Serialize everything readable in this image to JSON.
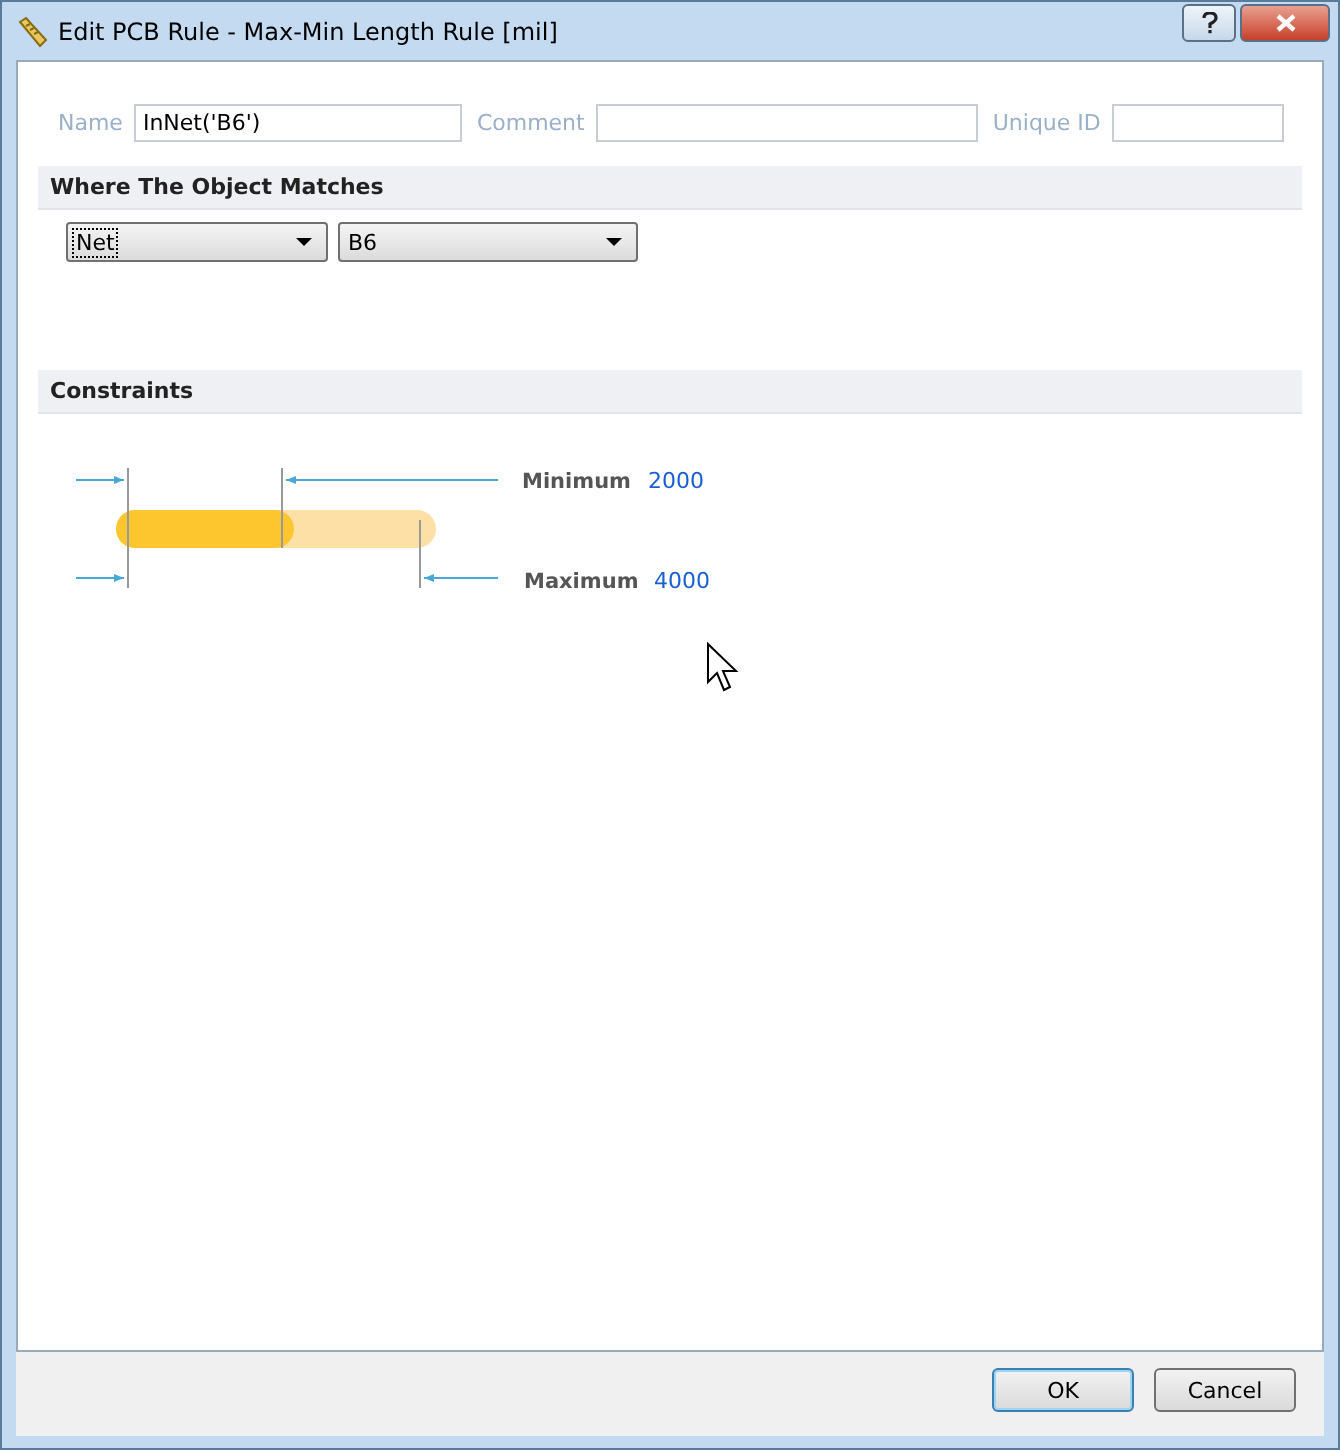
{
  "window": {
    "title": "Edit PCB Rule - Max-Min Length Rule [mil]"
  },
  "fields": [
    {
      "label": "Name",
      "value": "InNet('B6')"
    },
    {
      "label": "Comment"
    },
    {
      "label": "Unique ID"
    }
  ],
  "match_section": {
    "title": "Where The Object Matches",
    "dropdowns": [
      {
        "value": "Net"
      },
      {
        "value": "B6"
      }
    ]
  },
  "constraints": {
    "title": "Constraints",
    "minimum": {
      "label": "Minimum",
      "value": "2000"
    },
    "maximum": {
      "label": "Maximum",
      "value": "4000"
    }
  },
  "buttons": [
    {
      "label": "OK",
      "default": true
    },
    {
      "label": "Cancel",
      "default": false
    }
  ]
}
